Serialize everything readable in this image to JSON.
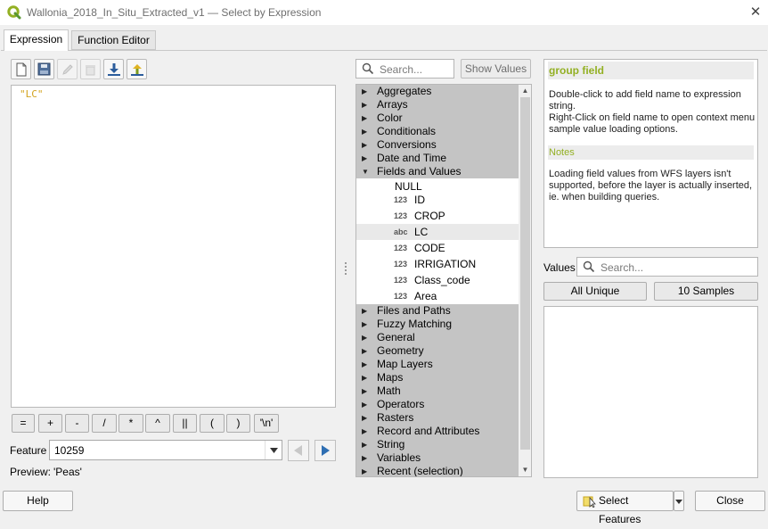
{
  "window": {
    "title": "Wallonia_2018_In_Situ_Extracted_v1 — Select by Expression",
    "close_glyph": "✕",
    "logo_icon": "qgis-logo-icon"
  },
  "tabs": [
    {
      "label": "Expression",
      "active": true
    },
    {
      "label": "Function Editor",
      "active": false
    }
  ],
  "toolbar": {
    "icons": [
      "new-file-icon",
      "save-icon",
      "edit-icon",
      "delete-icon",
      "import-icon",
      "export-icon"
    ]
  },
  "editor": {
    "text": "\"LC\""
  },
  "operators": [
    "=",
    "+",
    "-",
    "/",
    "*",
    "^",
    "||",
    "(",
    ")",
    "'\\n'"
  ],
  "feature": {
    "label": "Feature",
    "value": "10259"
  },
  "preview": {
    "label": "Preview:",
    "value": "'Peas'"
  },
  "search": {
    "placeholder": "Search..."
  },
  "show_values": "Show Values",
  "tree": {
    "groups_before": [
      "Aggregates",
      "Arrays",
      "Color",
      "Conditionals",
      "Conversions",
      "Date and Time"
    ],
    "expanded_group": "Fields and Values",
    "null_item": "NULL",
    "fields": [
      {
        "type": "123",
        "name": "ID"
      },
      {
        "type": "123",
        "name": "CROP"
      },
      {
        "type": "abc",
        "name": "LC",
        "selected": true
      },
      {
        "type": "123",
        "name": "CODE"
      },
      {
        "type": "123",
        "name": "IRRIGATION"
      },
      {
        "type": "123",
        "name": "Class_code"
      },
      {
        "type": "123",
        "name": "Area"
      }
    ],
    "groups_after": [
      "Files and Paths",
      "Fuzzy Matching",
      "General",
      "Geometry",
      "Map Layers",
      "Maps",
      "Math",
      "Operators",
      "Rasters",
      "Record and Attributes",
      "String",
      "Variables",
      "Recent (selection)"
    ]
  },
  "help": {
    "title": "group field",
    "body_line1": "Double-click to add field name to expression string.",
    "body_line2": "Right-Click on field name to open context menu sample value loading options.",
    "notes_heading": "Notes",
    "notes": "Loading field values from WFS layers isn't supported, before the layer is actually inserted, ie. when building queries."
  },
  "values": {
    "label": "Values",
    "placeholder": "Search...",
    "all_unique": "All Unique",
    "samples": "10 Samples"
  },
  "buttons": {
    "help": "Help",
    "select_features": "Select Features",
    "close": "Close"
  },
  "colors": {
    "accent_green": "#93b023",
    "expression_string": "#d2a21b",
    "group_row": "#c4c4c4"
  }
}
